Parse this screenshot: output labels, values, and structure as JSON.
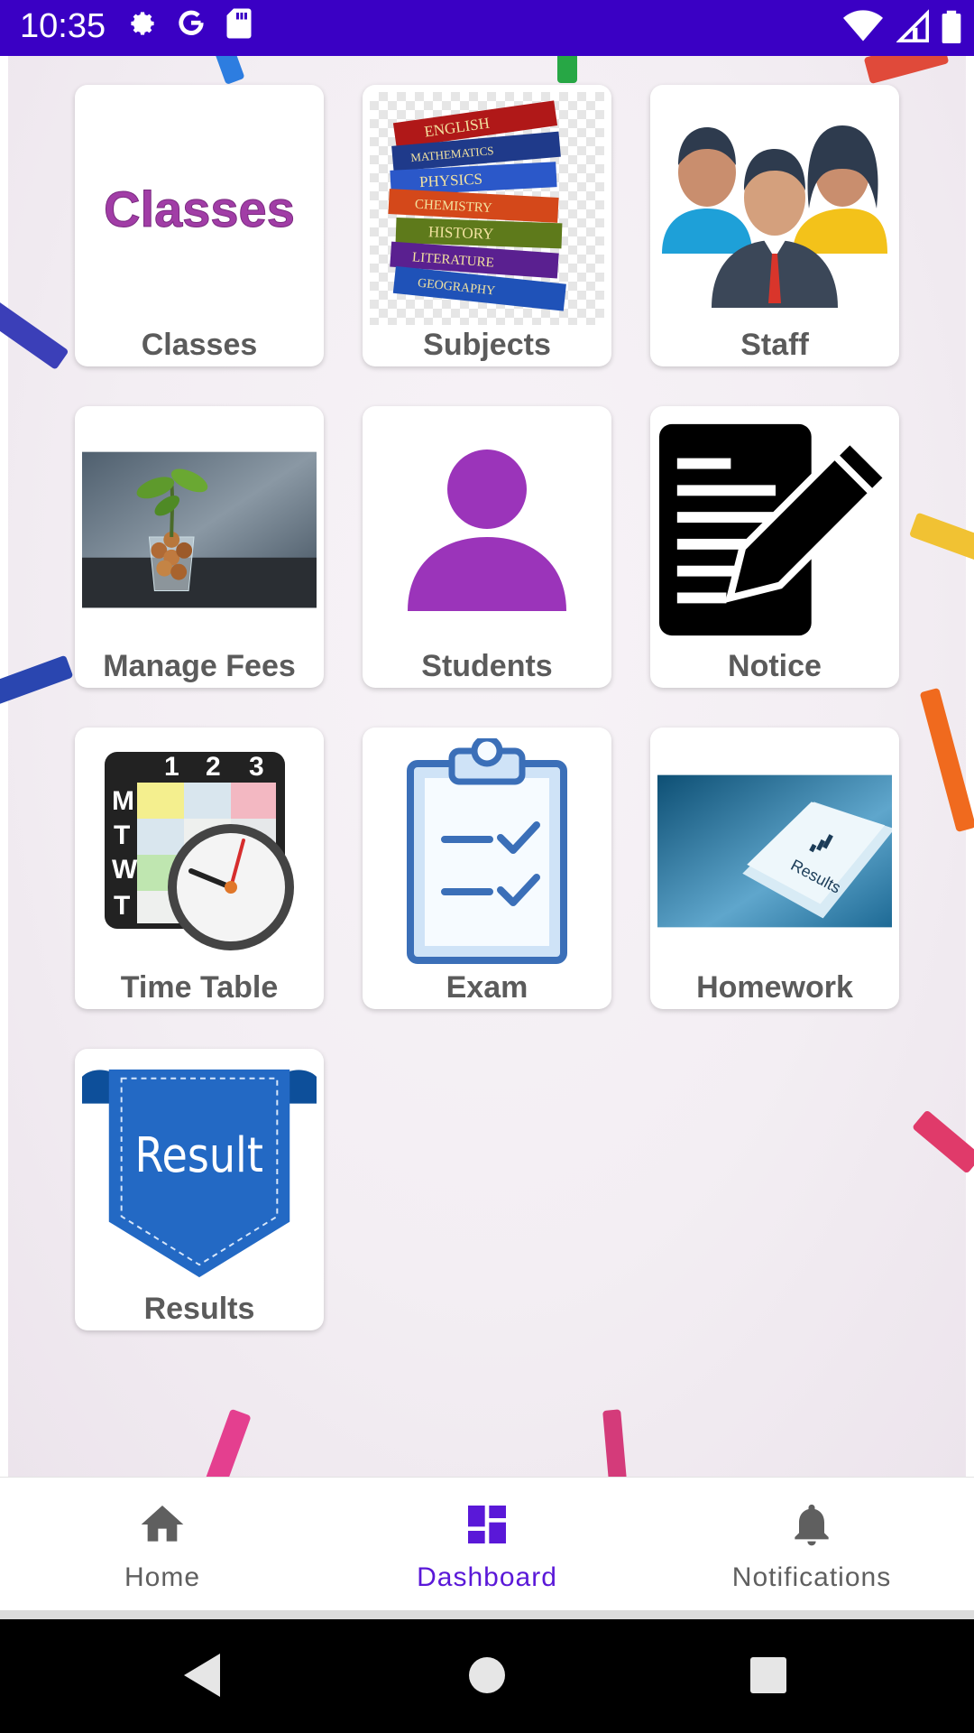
{
  "status_bar": {
    "time": "10:35",
    "left_icons": [
      "gear-icon",
      "google-icon",
      "sd-card-icon"
    ],
    "right_icons": [
      "wifi-icon",
      "signal-icon",
      "battery-icon"
    ],
    "background": "#3a00c4"
  },
  "art": {
    "classes_word": "Classes",
    "books": [
      "ENGLISH",
      "MATHEMATICS",
      "PHYSICS",
      "CHEMISTRY",
      "HISTORY",
      "LITERATURE",
      "GEOGRAPHY"
    ],
    "timetable_days": [
      "M",
      "T",
      "W",
      "T"
    ],
    "timetable_cols": [
      "1",
      "2",
      "3"
    ],
    "homework_key": "Results",
    "result_ribbon": "Result"
  },
  "tiles": [
    {
      "label": "Classes"
    },
    {
      "label": "Subjects"
    },
    {
      "label": "Staff"
    },
    {
      "label": "Manage Fees"
    },
    {
      "label": "Students"
    },
    {
      "label": "Notice"
    },
    {
      "label": "Time Table"
    },
    {
      "label": "Exam"
    },
    {
      "label": "Homework"
    },
    {
      "label": "Results"
    }
  ],
  "bottom_nav": {
    "items": [
      {
        "label": "Home",
        "icon": "home-icon",
        "active": false
      },
      {
        "label": "Dashboard",
        "icon": "dashboard-icon",
        "active": true
      },
      {
        "label": "Notifications",
        "icon": "bell-icon",
        "active": false
      }
    ],
    "active_color": "#5a18d8",
    "inactive_color": "#5f5f5f"
  },
  "system_nav": [
    "back-icon",
    "home-circle-icon",
    "recents-icon"
  ]
}
